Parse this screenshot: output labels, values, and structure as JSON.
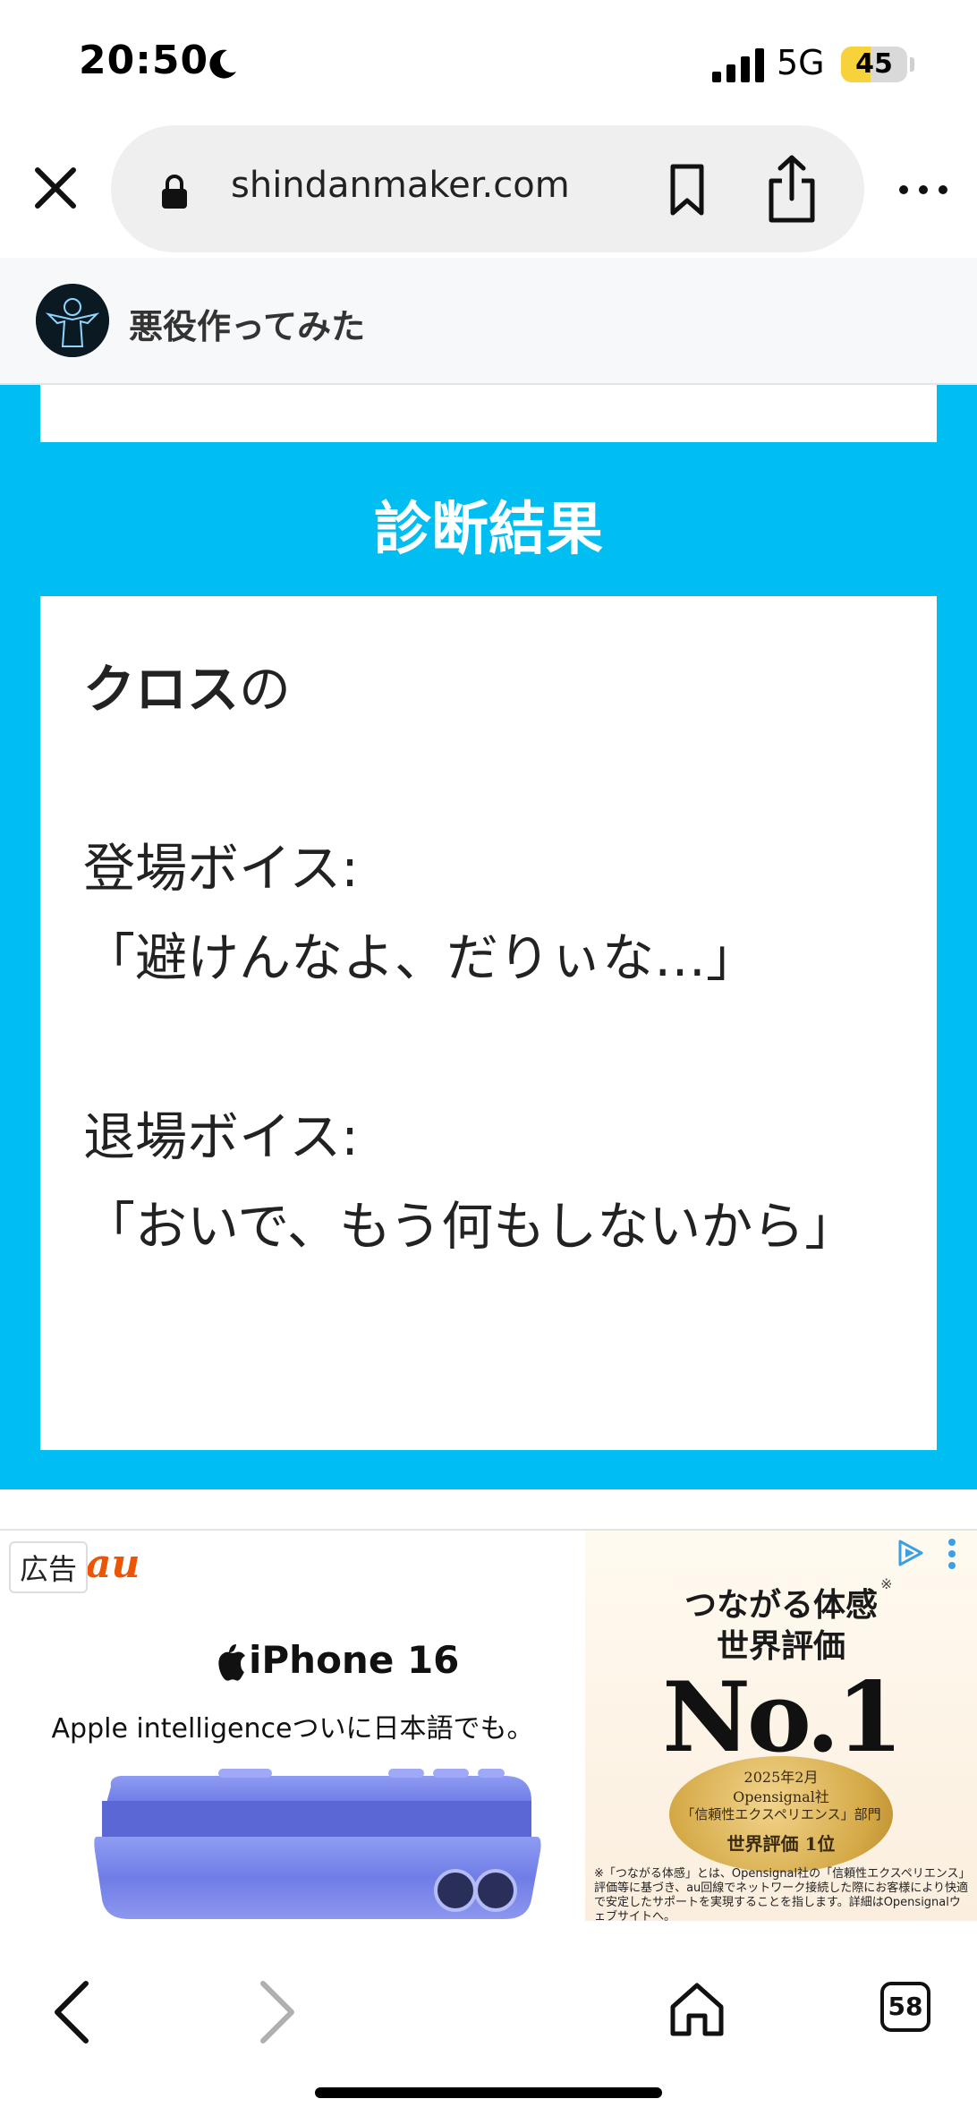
{
  "status_bar": {
    "time": "20:50",
    "network": "5G",
    "battery_level": "45",
    "battery_fraction": 0.45,
    "icons": [
      "moon-icon",
      "signal-icon"
    ]
  },
  "browser": {
    "url": "shindanmaker.com",
    "icons": [
      "close-icon",
      "lock-icon",
      "bookmark-icon",
      "share-icon",
      "more-icon"
    ]
  },
  "site": {
    "title": "悪役作ってみた"
  },
  "result": {
    "heading": "診断結果",
    "name": "クロス",
    "name_suffix": "の",
    "body": "\n\n登場ボイス:\n「避けんなよ、だりぃな…」\n\n退場ボイス:\n「おいで、もう何もしないから」"
  },
  "ad": {
    "badge": "広告",
    "brand": "au",
    "product": "iPhone 16",
    "subtitle": "Apple intelligenceついに日本語でも。",
    "right_title_line1": "つながる体感",
    "right_title_line2": "世界評価",
    "right_mark": "※",
    "right_no1": "No.1",
    "medal_line1": "2025年2月",
    "medal_line2": "Opensignal社",
    "medal_line3": "「信頼性エクスペリエンス」部門",
    "medal_line4": "世界評価 1位",
    "footnote": "※「つながる体感」とは、Opensignal社の「信頼性エクスペリエンス」評価等に基づき、au回線でネットワーク接続した際にお客様により快適で安定したサポートを実現することを指します。詳細はOpensignalウェブサイトへ。",
    "colors": {
      "brand": "#eb5505",
      "panel": "#00bdf2"
    }
  },
  "toolbar": {
    "tabs_count": "58",
    "icons": [
      "back-icon",
      "forward-icon",
      "home-icon",
      "tabs-icon"
    ]
  }
}
